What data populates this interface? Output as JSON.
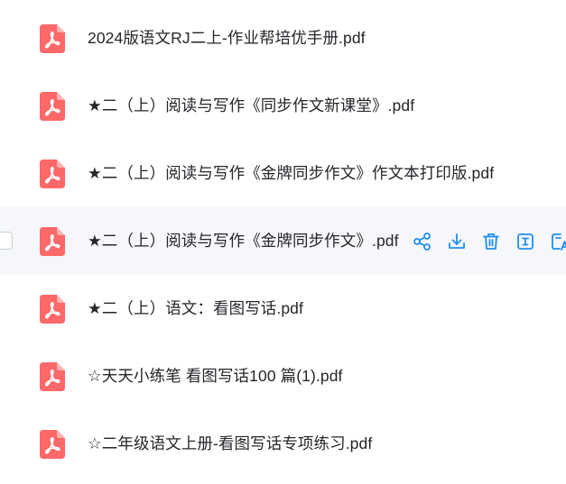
{
  "colors": {
    "pdf_icon": "#fd6869",
    "action_icon": "#1f8ef1",
    "row_hover_bg": "#f5f7fb",
    "text": "#25262b"
  },
  "files": [
    {
      "name": "2024版语文RJ二上-作业帮培优手册.pdf",
      "icon": "pdf-icon"
    },
    {
      "name": "★二（上）阅读与写作《同步作文新课堂》.pdf",
      "icon": "pdf-icon"
    },
    {
      "name": "★二（上）阅读与写作《金牌同步作文》作文本打印版.pdf",
      "icon": "pdf-icon"
    },
    {
      "name": "★二（上）阅读与写作《金牌同步作文》.pdf",
      "icon": "pdf-icon",
      "hovered": true
    },
    {
      "name": "★二（上）语文：看图写话.pdf",
      "icon": "pdf-icon"
    },
    {
      "name": "☆天天小练笔 看图写话100 篇(1).pdf",
      "icon": "pdf-icon"
    },
    {
      "name": "☆二年级语文上册-看图写话专项练习.pdf",
      "icon": "pdf-icon"
    }
  ],
  "row_actions": [
    {
      "icon": "share-icon"
    },
    {
      "icon": "download-icon"
    },
    {
      "icon": "delete-icon"
    },
    {
      "icon": "text-recognize-icon"
    },
    {
      "icon": "translate-icon"
    }
  ]
}
